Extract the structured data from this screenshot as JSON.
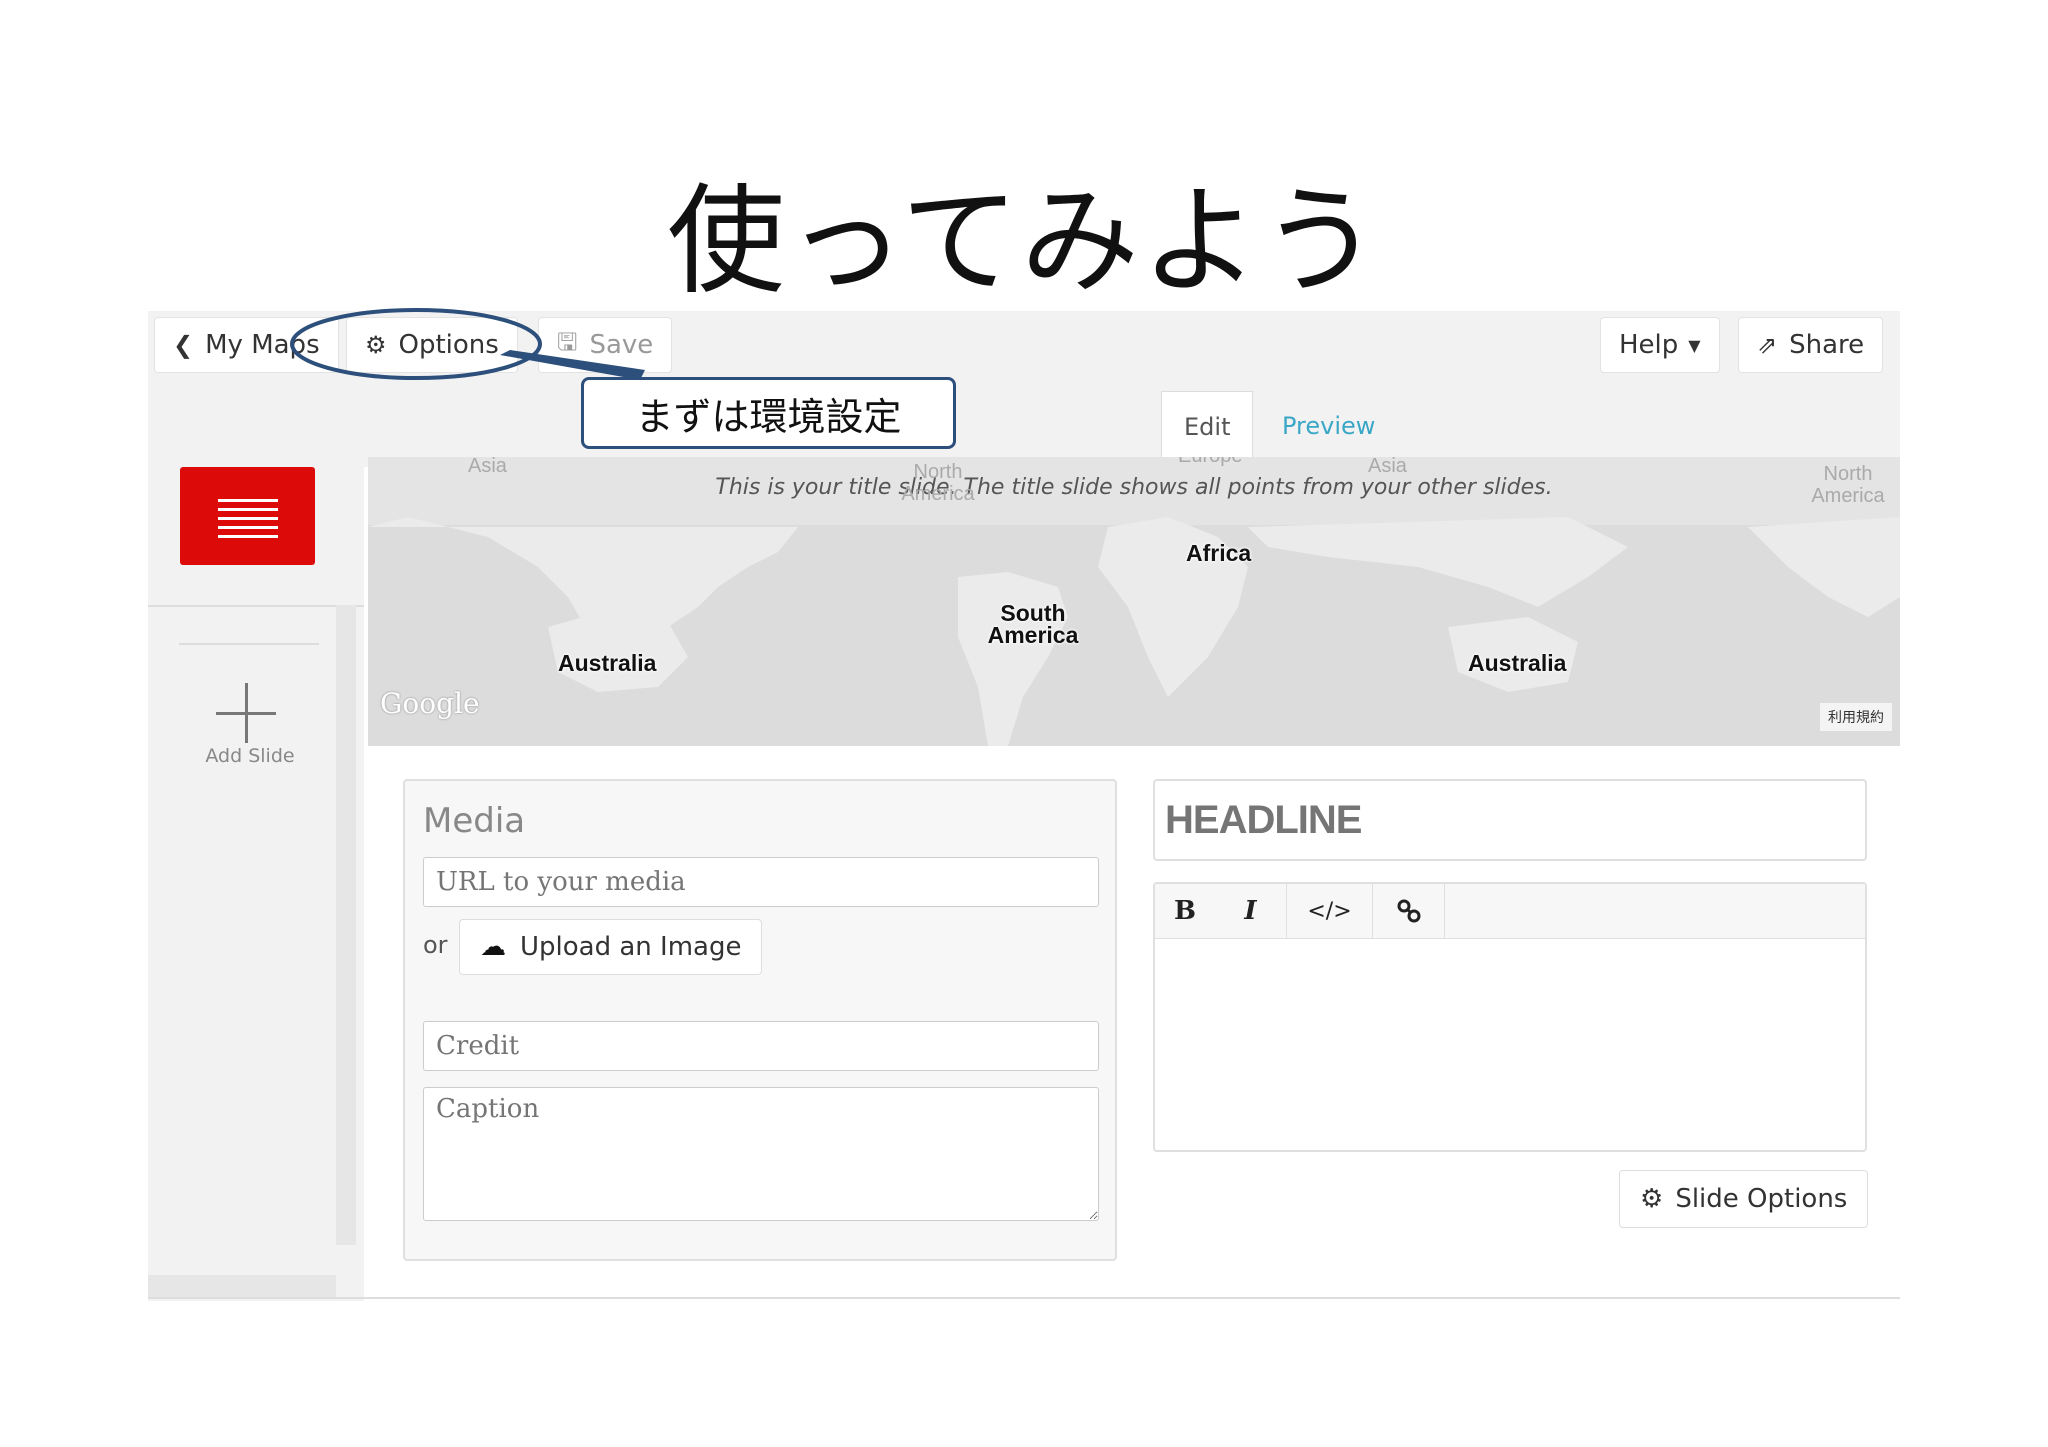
{
  "slide": {
    "title": "使ってみよう"
  },
  "topbar": {
    "my_maps": "My Maps",
    "options": "Options",
    "save": "Save",
    "help": "Help",
    "share": "Share"
  },
  "annotation": {
    "callout": "まずは環境設定"
  },
  "tabs": {
    "edit": "Edit",
    "preview": "Preview"
  },
  "sidebar": {
    "add_slide": "Add Slide"
  },
  "map": {
    "caption": "This is your title slide. The title slide shows all points from your other slides.",
    "labels": {
      "asia_left": "Asia",
      "north_america_faint": "North America",
      "europe": "Europe",
      "asia_right": "Asia",
      "north_america_right": "North America",
      "africa": "Africa",
      "south_america": "South America",
      "australia_left": "Australia",
      "australia_right": "Australia"
    },
    "google": "Google",
    "terms": "利用規約"
  },
  "media": {
    "title": "Media",
    "url_placeholder": "URL to your media",
    "or": "or",
    "upload": "Upload an Image",
    "credit_placeholder": "Credit",
    "caption_placeholder": "Caption"
  },
  "text": {
    "headline_placeholder": "HEADLINE",
    "toolbar": {
      "bold": "B",
      "italic": "I",
      "code": "</>",
      "link_icon": "link-icon"
    }
  },
  "slide_options": "Slide Options",
  "colors": {
    "accent_red": "#dd0a0a",
    "link_blue": "#3ba7c6",
    "annotation_blue": "#2d4f7c"
  }
}
